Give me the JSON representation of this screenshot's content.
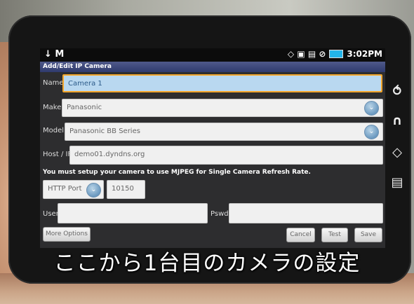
{
  "statusbar": {
    "left_icons": "↓ M",
    "right_icons": "◇ ▣ ▤ ⊘",
    "time": "3:02PM"
  },
  "app": {
    "title": "Add/Edit IP Camera"
  },
  "form": {
    "name_label": "Name",
    "name_value": "Camera 1",
    "make_label": "Make",
    "make_value": "Panasonic",
    "model_label": "Model",
    "model_value": "Panasonic BB Series",
    "host_label": "Host / IP",
    "host_value": "demo01.dyndns.org",
    "note": "You must setup your camera to use MJPEG for Single Camera Refresh Rate.",
    "port_type": "HTTP Port",
    "port_value": "10150",
    "user_label": "User",
    "user_value": "",
    "pswd_label": "Pswd",
    "pswd_value": ""
  },
  "buttons": {
    "more_options": "More Options",
    "cancel": "Cancel",
    "test": "Test",
    "save": "Save"
  },
  "caption": "ここから1台目のカメラの設定",
  "hardware_buttons": [
    "⥀",
    "∩",
    "◇",
    "▤"
  ]
}
